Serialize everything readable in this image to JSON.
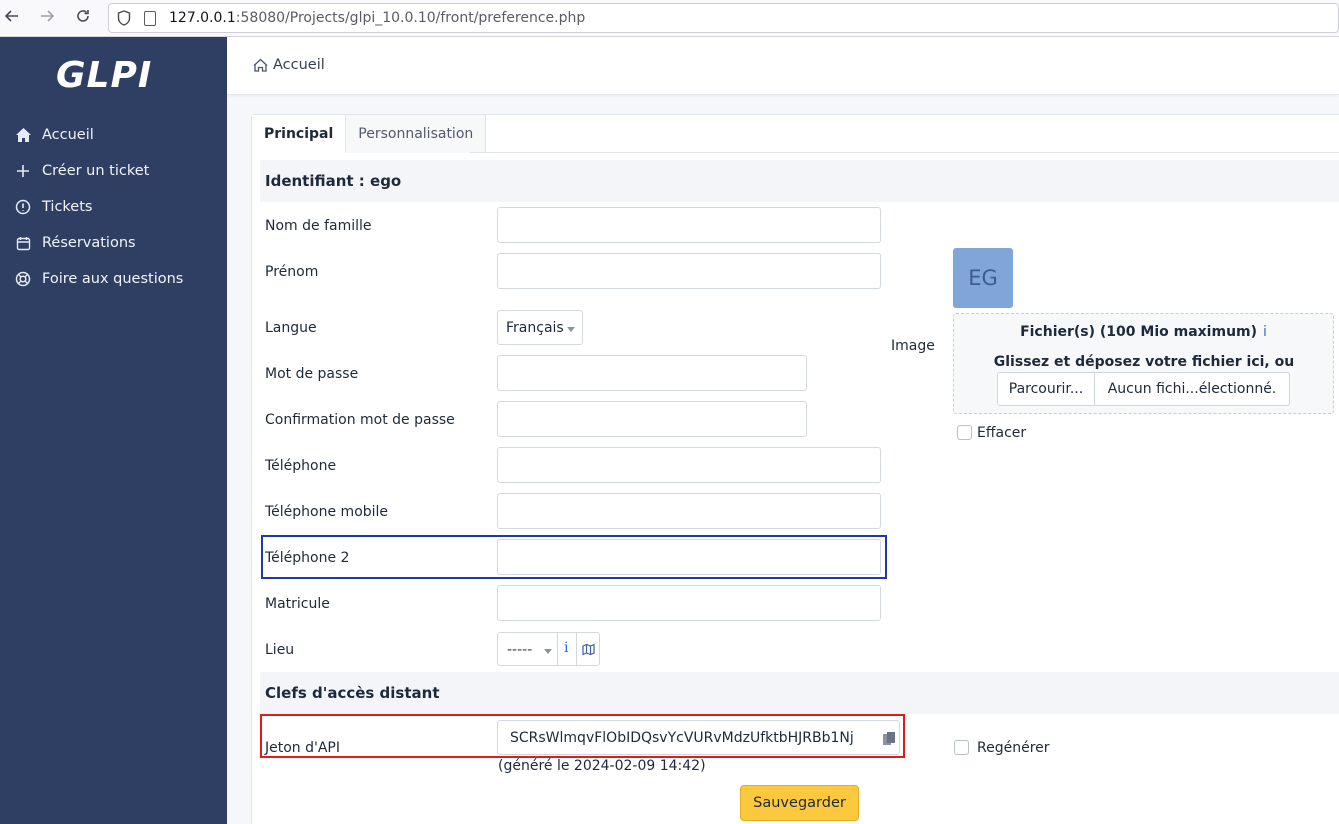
{
  "browser": {
    "url_host": "127.0.0.1",
    "url_rest": ":58080/Projects/glpi_10.0.10/front/preference.php"
  },
  "sidebar": {
    "logo": "GLPI",
    "items": [
      {
        "label": "Accueil",
        "icon": "home-icon"
      },
      {
        "label": "Créer un ticket",
        "icon": "plus-icon"
      },
      {
        "label": "Tickets",
        "icon": "alert-circle-icon"
      },
      {
        "label": "Réservations",
        "icon": "calendar-icon"
      },
      {
        "label": "Foire aux questions",
        "icon": "lifebuoy-icon"
      }
    ]
  },
  "header": {
    "breadcrumb": "Accueil"
  },
  "tabs": [
    {
      "label": "Principal",
      "active": true
    },
    {
      "label": "Personnalisation",
      "active": false
    }
  ],
  "form": {
    "section_identity": "Identifiant : ego",
    "fields": {
      "lastname": {
        "label": "Nom de famille",
        "value": ""
      },
      "firstname": {
        "label": "Prénom",
        "value": ""
      },
      "language": {
        "label": "Langue",
        "value": "Français"
      },
      "password": {
        "label": "Mot de passe",
        "value": ""
      },
      "password_confirm": {
        "label": "Confirmation mot de passe",
        "value": ""
      },
      "phone": {
        "label": "Téléphone",
        "value": ""
      },
      "mobile": {
        "label": "Téléphone mobile",
        "value": ""
      },
      "phone2": {
        "label": "Téléphone 2",
        "value": ""
      },
      "registration": {
        "label": "Matricule",
        "value": ""
      },
      "location": {
        "label": "Lieu",
        "value": "-----"
      }
    },
    "image": {
      "label": "Image",
      "avatar_initials": "EG",
      "dropzone_title": "Fichier(s) (100 Mio maximum)",
      "dropzone_info": "i",
      "dropzone_hint": "Glissez et déposez votre fichier ici, ou",
      "browse_label": "Parcourir...",
      "file_status": "Aucun fichi...électionné.",
      "clear_label": "Effacer"
    },
    "section_api": "Clefs d'accès distant",
    "api": {
      "label": "Jeton d'API",
      "token": "SCRsWlmqvFlObIDQsvYcVURvMdzUfktbHJRBb1Nj",
      "generated": "(généré le 2024-02-09 14:42)",
      "regenerate_label": "Regénérer"
    },
    "save_label": "Sauvegarder"
  }
}
